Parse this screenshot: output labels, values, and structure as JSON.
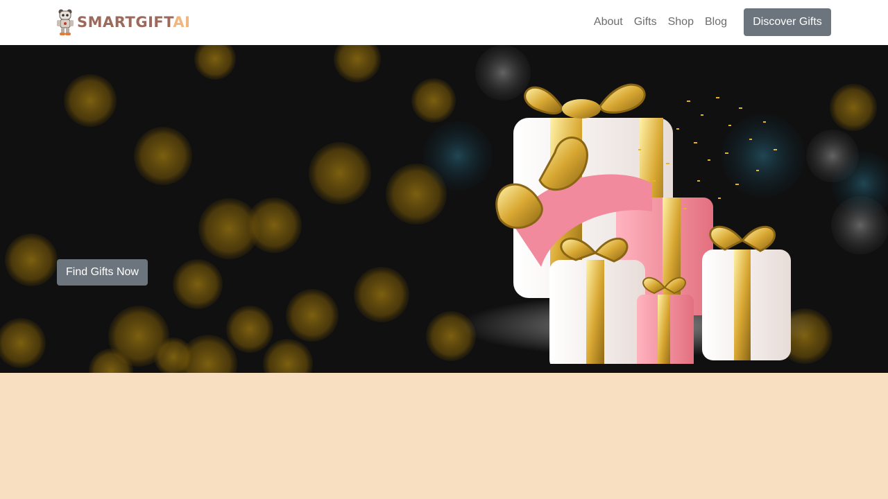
{
  "brand": {
    "name_part1": "SMARTGIFT",
    "name_part2": "AI",
    "logo_icon": "robot-mascot-icon"
  },
  "nav": {
    "items": [
      {
        "label": "About"
      },
      {
        "label": "Gifts"
      },
      {
        "label": "Shop"
      },
      {
        "label": "Blog"
      }
    ],
    "cta_label": "Discover Gifts"
  },
  "hero": {
    "cta_label": "Find Gifts Now",
    "image": "gift-boxes-illustration"
  },
  "colors": {
    "navbar_bg": "#ffffff",
    "button_bg": "#6c757d",
    "page_bg": "#f9dfc2",
    "hero_bg": "#111111",
    "brand_primary": "#9c6a5c",
    "brand_accent": "#f1b57d"
  }
}
